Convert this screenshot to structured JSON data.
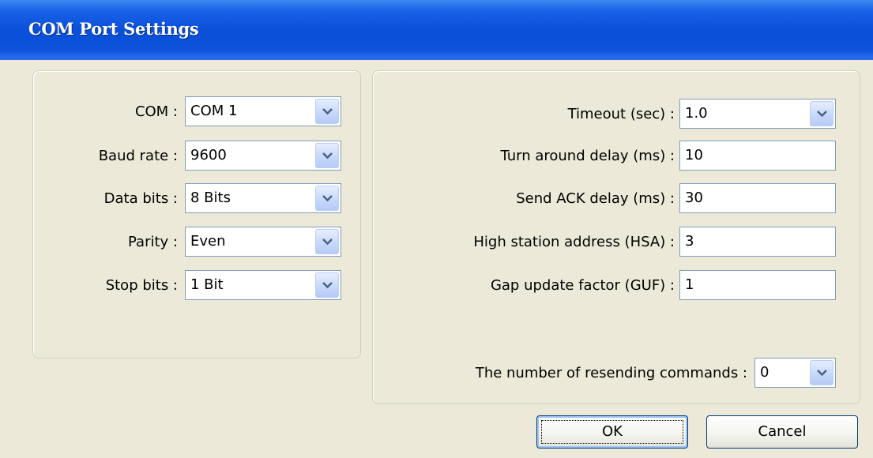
{
  "window": {
    "title": "COM Port Settings"
  },
  "left_group": {
    "fields": [
      {
        "label": "COM :",
        "value": "COM 1"
      },
      {
        "label": "Baud rate :",
        "value": "9600"
      },
      {
        "label": "Data bits :",
        "value": "8 Bits"
      },
      {
        "label": "Parity :",
        "value": "Even"
      },
      {
        "label": "Stop bits :",
        "value": "1 Bit"
      }
    ]
  },
  "right_group": {
    "timeout": {
      "label": "Timeout (sec) :",
      "value": "1.0"
    },
    "turn_around": {
      "label": "Turn around delay (ms) :",
      "value": "10"
    },
    "send_ack": {
      "label": "Send ACK delay (ms) :",
      "value": "30"
    },
    "hsa": {
      "label": "High station address (HSA) :",
      "value": "3"
    },
    "guf": {
      "label": "Gap update factor (GUF) :",
      "value": "1"
    },
    "resend": {
      "label": "The number of resending commands :",
      "value": "0"
    }
  },
  "buttons": {
    "ok": "OK",
    "cancel": "Cancel"
  },
  "icons": {
    "dropdown": "chevron-down-icon"
  },
  "colors": {
    "title_bar": "#0a4fd8",
    "dialog_bg": "#ece9d8",
    "field_border": "#7f9db9"
  }
}
